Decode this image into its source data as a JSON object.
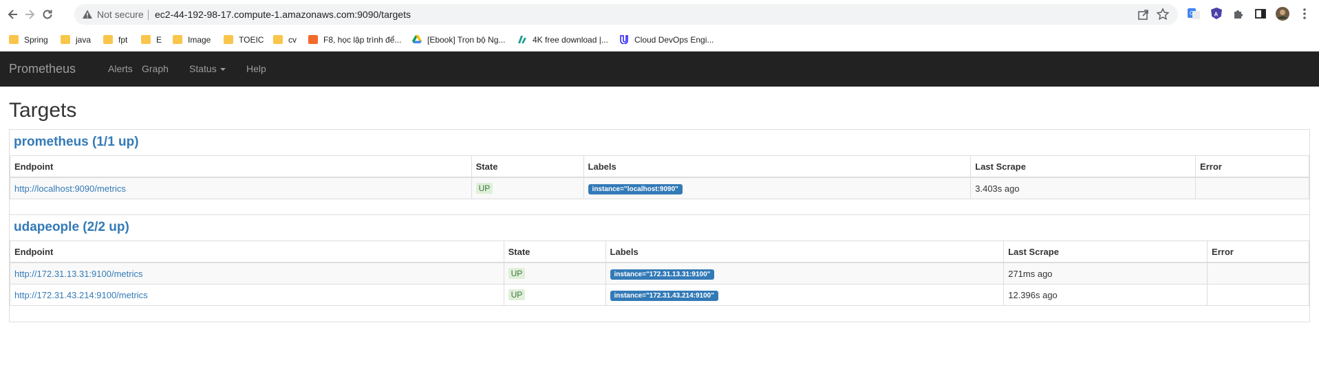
{
  "browser": {
    "security_label": "Not secure",
    "url": "ec2-44-192-98-17.compute-1.amazonaws.com:9090/targets",
    "bookmarks": [
      {
        "label": "Spring",
        "icon": "folder-icon"
      },
      {
        "label": "java",
        "icon": "folder-icon"
      },
      {
        "label": "fpt",
        "icon": "folder-icon"
      },
      {
        "label": "E",
        "icon": "folder-icon"
      },
      {
        "label": "Image",
        "icon": "folder-icon"
      },
      {
        "label": "TOEIC",
        "icon": "folder-icon"
      },
      {
        "label": "cv",
        "icon": "folder-icon"
      },
      {
        "label": "F8, học lập trình để...",
        "icon": "f8-icon"
      },
      {
        "label": "[Ebook] Trọn bộ Ng...",
        "icon": "google-drive-icon"
      },
      {
        "label": "4K free download |...",
        "icon": "4k-download-icon"
      },
      {
        "label": "Cloud DevOps Engi...",
        "icon": "udacity-icon"
      }
    ]
  },
  "navbar": {
    "brand": "Prometheus",
    "links": [
      "Alerts",
      "Graph",
      "Status",
      "Help"
    ]
  },
  "page": {
    "title": "Targets"
  },
  "jobs": [
    {
      "title": "prometheus (1/1 up)",
      "columns": [
        "Endpoint",
        "State",
        "Labels",
        "Last Scrape",
        "Error"
      ],
      "rows": [
        {
          "endpoint": "http://localhost:9090/metrics",
          "state": "UP",
          "label": "instance=\"localhost:9090\"",
          "last_scrape": "3.403s ago",
          "error": ""
        }
      ]
    },
    {
      "title": "udapeople (2/2 up)",
      "columns": [
        "Endpoint",
        "State",
        "Labels",
        "Last Scrape",
        "Error"
      ],
      "rows": [
        {
          "endpoint": "http://172.31.13.31:9100/metrics",
          "state": "UP",
          "label": "instance=\"172.31.13.31:9100\"",
          "last_scrape": "271ms ago",
          "error": ""
        },
        {
          "endpoint": "http://172.31.43.214:9100/metrics",
          "state": "UP",
          "label": "instance=\"172.31.43.214:9100\"",
          "last_scrape": "12.396s ago",
          "error": ""
        }
      ]
    }
  ],
  "colors": {
    "navbar_bg": "#222222",
    "link": "#337ab7",
    "state_up_bg": "#dff0d8",
    "state_up_text": "#3c763d",
    "label_bg": "#337ab7"
  }
}
